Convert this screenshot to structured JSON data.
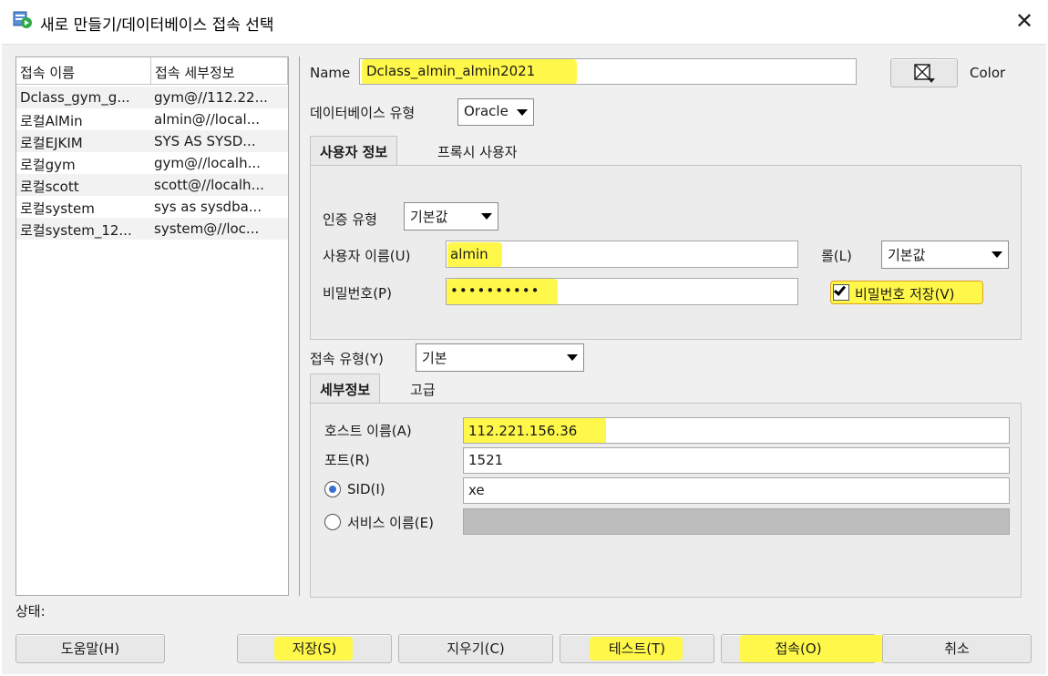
{
  "window": {
    "title": "새로 만들기/데이터베이스 접속 선택",
    "close_symbol": "✕"
  },
  "connections": {
    "headers": [
      "접속 이름",
      "접속 세부정보"
    ],
    "rows": [
      {
        "name": "Dclass_gym_g...",
        "details": "gym@//112.22..."
      },
      {
        "name": "로컬AlMin",
        "details": "almin@//local..."
      },
      {
        "name": "로컬EJKIM",
        "details": "SYS AS SYSD..."
      },
      {
        "name": "로컬gym",
        "details": "gym@//localh..."
      },
      {
        "name": "로컬scott",
        "details": "scott@//localh..."
      },
      {
        "name": "로컬system",
        "details": "sys as sysdba..."
      },
      {
        "name": "로컬system_12...",
        "details": "system@//loc..."
      }
    ]
  },
  "form": {
    "name_label": "Name",
    "name_value": "Dclass_almin_almin2021",
    "color_label": "Color",
    "db_type_label": "데이터베이스 유형",
    "db_type_value": "Oracle",
    "tabs": [
      "사용자 정보",
      "프록시 사용자"
    ],
    "auth_type_label": "인증 유형",
    "auth_type_value": "기본값",
    "username_label": "사용자 이름(U)",
    "username_value": "almin",
    "role_label": "롤(L)",
    "role_value": "기본값",
    "password_label": "비밀번호(P)",
    "password_value": "••••••••••",
    "save_password_label": "비밀번호 저장(V)",
    "save_password_checked": true,
    "conn_type_label": "접속 유형(Y)",
    "conn_type_value": "기본",
    "detail_tabs": [
      "세부정보",
      "고급"
    ],
    "host_label": "호스트 이름(A)",
    "host_value": "112.221.156.36",
    "port_label": "포트(R)",
    "port_value": "1521",
    "sid_label": "SID(I)",
    "sid_value": "xe",
    "service_label": "서비스 이름(E)",
    "service_value": ""
  },
  "status": {
    "label": "상태:"
  },
  "buttons": {
    "help": "도움말(H)",
    "save": "저장(S)",
    "clear": "지우기(C)",
    "test": "테스트(T)",
    "connect": "접속(O)",
    "cancel": "취소"
  },
  "colors": {
    "highlight": "#fff84a",
    "dialog_bg": "#f0f0f0",
    "radio_selected": "#3a6fd0"
  }
}
